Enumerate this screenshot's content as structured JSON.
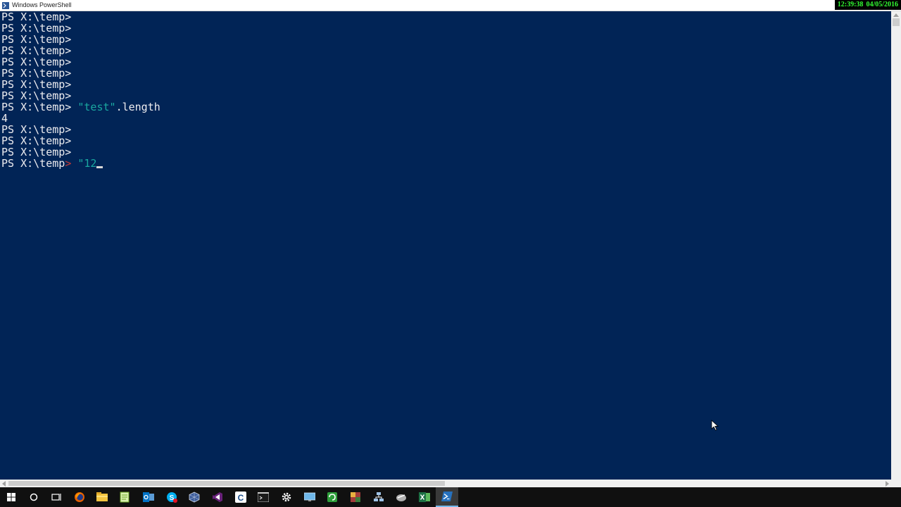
{
  "window": {
    "title": "Windows PowerShell"
  },
  "clock": {
    "time": "12:39:38",
    "date": "04/05/2016",
    "color": "#33ff33"
  },
  "console": {
    "background": "#012456",
    "lines": [
      {
        "prompt": "PS X:\\temp>",
        "text": ""
      },
      {
        "prompt": "PS X:\\temp>",
        "text": ""
      },
      {
        "prompt": "PS X:\\temp>",
        "text": ""
      },
      {
        "prompt": "PS X:\\temp>",
        "text": ""
      },
      {
        "prompt": "PS X:\\temp>",
        "text": ""
      },
      {
        "prompt": "PS X:\\temp>",
        "text": ""
      },
      {
        "prompt": "PS X:\\temp>",
        "text": ""
      },
      {
        "prompt": "PS X:\\temp>",
        "text": ""
      },
      {
        "prompt": "PS X:\\temp>",
        "text": ""
      }
    ],
    "command_line": {
      "prompt": "PS X:\\temp>",
      "string_literal": "\"test\"",
      "member": ".length"
    },
    "output": "4",
    "more_prompts": [
      "PS X:\\temp>",
      "PS X:\\temp>",
      "PS X:\\temp>"
    ],
    "current_line": {
      "prompt_base": "PS X:\\temp",
      "prompt_gt": ">",
      "input": "\"12"
    }
  },
  "taskbar": {
    "items": [
      {
        "name": "start-icon",
        "active": false
      },
      {
        "name": "cortana-search-icon",
        "active": false
      },
      {
        "name": "task-view-icon",
        "active": false
      },
      {
        "name": "firefox-icon",
        "active": false
      },
      {
        "name": "file-explorer-icon",
        "active": false
      },
      {
        "name": "notepad-plus-plus-icon",
        "active": false
      },
      {
        "name": "outlook-icon",
        "active": false
      },
      {
        "name": "skype-icon",
        "active": false
      },
      {
        "name": "virtualbox-icon",
        "active": false
      },
      {
        "name": "visual-studio-icon",
        "active": false
      },
      {
        "name": "ccleaner-icon",
        "active": false
      },
      {
        "name": "command-prompt-icon",
        "active": false
      },
      {
        "name": "settings-gear-icon",
        "active": false
      },
      {
        "name": "remote-desktop-icon",
        "active": false
      },
      {
        "name": "green-app-icon",
        "active": false
      },
      {
        "name": "winrar-icon",
        "active": false
      },
      {
        "name": "network-tool-icon",
        "active": false
      },
      {
        "name": "sketch-tool-icon",
        "active": false
      },
      {
        "name": "excel-icon",
        "active": false
      },
      {
        "name": "powershell-icon",
        "active": true
      }
    ]
  }
}
